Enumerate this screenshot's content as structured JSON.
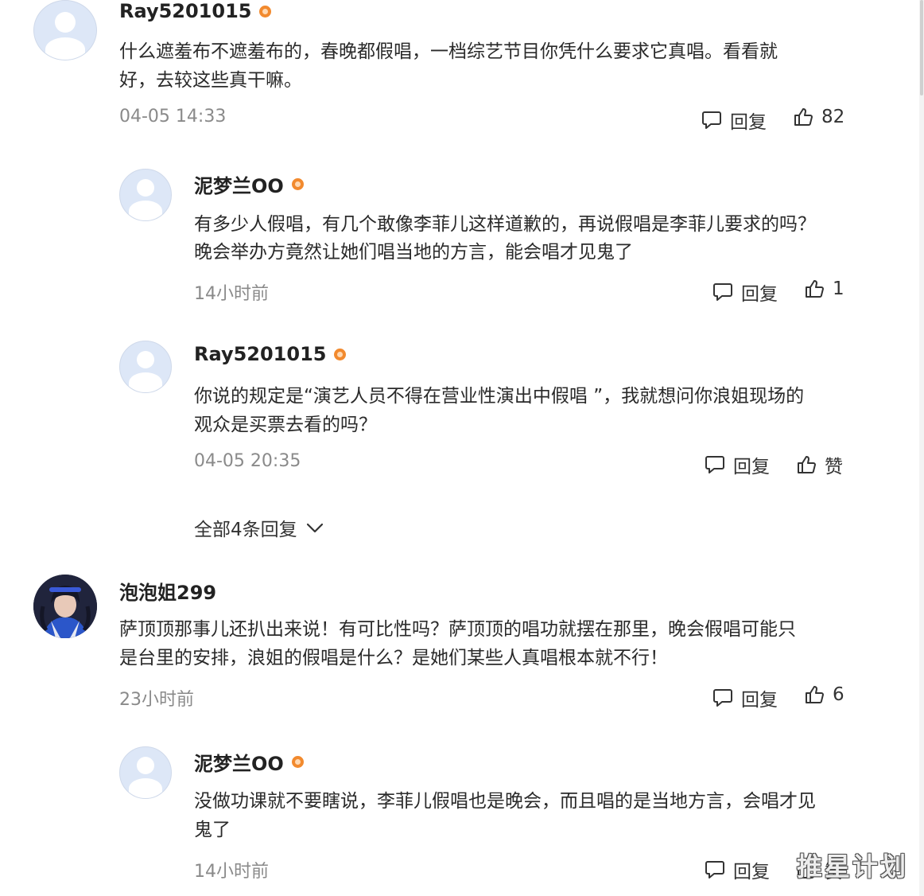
{
  "comments": [
    {
      "username": "Ray5201015",
      "lines": [
        "什么遮羞布不遮羞布的，春晚都假唱，一档综艺节目你凭什么要求它真唱。看看就",
        "好，去较这些真干嘛。"
      ],
      "time": "04-05 14:33",
      "reply_label": "回复",
      "like_label": "82"
    },
    {
      "username": "泥梦兰OO",
      "lines": [
        "有多少人假唱，有几个敢像李菲儿这样道歉的，再说假唱是李菲儿要求的吗？",
        "晚会举办方竟然让她们唱当地的方言，能会唱才见鬼了"
      ],
      "time": "14小时前",
      "reply_label": "回复",
      "like_label": "1"
    },
    {
      "username": "Ray5201015",
      "lines": [
        "你说的规定是“演艺人员不得在营业性演出中假唱 ”，我就想问你浪姐现场的",
        "观众是买票去看的吗？"
      ],
      "time": "04-05 20:35",
      "reply_label": "回复",
      "like_label": "赞"
    },
    {
      "username": "泡泡姐299",
      "lines": [
        "萨顶顶那事儿还扒出来说！有可比性吗？萨顶顶的唱功就摆在那里，晚会假唱可能只",
        "是台里的安排，浪姐的假唱是什么？是她们某些人真唱根本就不行！"
      ],
      "time": "23小时前",
      "reply_label": "回复",
      "like_label": "6"
    },
    {
      "username": "泥梦兰OO",
      "lines": [
        "没做功课就不要瞎说，李菲儿假唱也是晚会，而且唱的是当地方言，会唱才见",
        "鬼了"
      ],
      "time": "14小时前",
      "reply_label": "回复",
      "like_label": "赞"
    }
  ],
  "expand_replies": "全部4条回复",
  "watermark": "推星计划",
  "icons": {
    "reply": "comment-bubble-icon",
    "like": "thumbs-up-icon",
    "level": "level-badge-icon",
    "expand": "chevron-down-icon"
  },
  "colors": {
    "level_badge": "#f28a2e",
    "avatar_bg": "#dde7f7",
    "meta_text": "#8a8a8a"
  }
}
